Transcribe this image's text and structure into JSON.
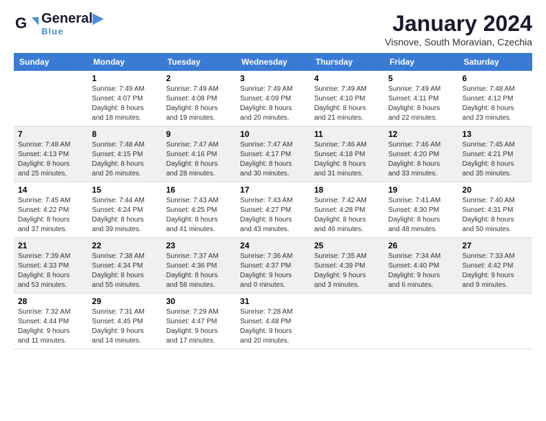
{
  "logo": {
    "general": "General",
    "blue": "Blue",
    "subtitle": ""
  },
  "header": {
    "title": "January 2024",
    "location": "Visnove, South Moravian, Czechia"
  },
  "columns": [
    "Sunday",
    "Monday",
    "Tuesday",
    "Wednesday",
    "Thursday",
    "Friday",
    "Saturday"
  ],
  "weeks": [
    {
      "days": [
        {
          "num": "",
          "info": ""
        },
        {
          "num": "1",
          "info": "Sunrise: 7:49 AM\nSunset: 4:07 PM\nDaylight: 8 hours\nand 18 minutes."
        },
        {
          "num": "2",
          "info": "Sunrise: 7:49 AM\nSunset: 4:08 PM\nDaylight: 8 hours\nand 19 minutes."
        },
        {
          "num": "3",
          "info": "Sunrise: 7:49 AM\nSunset: 4:09 PM\nDaylight: 8 hours\nand 20 minutes."
        },
        {
          "num": "4",
          "info": "Sunrise: 7:49 AM\nSunset: 4:10 PM\nDaylight: 8 hours\nand 21 minutes."
        },
        {
          "num": "5",
          "info": "Sunrise: 7:49 AM\nSunset: 4:11 PM\nDaylight: 8 hours\nand 22 minutes."
        },
        {
          "num": "6",
          "info": "Sunrise: 7:48 AM\nSunset: 4:12 PM\nDaylight: 8 hours\nand 23 minutes."
        }
      ]
    },
    {
      "days": [
        {
          "num": "7",
          "info": "Sunrise: 7:48 AM\nSunset: 4:13 PM\nDaylight: 8 hours\nand 25 minutes."
        },
        {
          "num": "8",
          "info": "Sunrise: 7:48 AM\nSunset: 4:15 PM\nDaylight: 8 hours\nand 26 minutes."
        },
        {
          "num": "9",
          "info": "Sunrise: 7:47 AM\nSunset: 4:16 PM\nDaylight: 8 hours\nand 28 minutes."
        },
        {
          "num": "10",
          "info": "Sunrise: 7:47 AM\nSunset: 4:17 PM\nDaylight: 8 hours\nand 30 minutes."
        },
        {
          "num": "11",
          "info": "Sunrise: 7:46 AM\nSunset: 4:18 PM\nDaylight: 8 hours\nand 31 minutes."
        },
        {
          "num": "12",
          "info": "Sunrise: 7:46 AM\nSunset: 4:20 PM\nDaylight: 8 hours\nand 33 minutes."
        },
        {
          "num": "13",
          "info": "Sunrise: 7:45 AM\nSunset: 4:21 PM\nDaylight: 8 hours\nand 35 minutes."
        }
      ]
    },
    {
      "days": [
        {
          "num": "14",
          "info": "Sunrise: 7:45 AM\nSunset: 4:22 PM\nDaylight: 8 hours\nand 37 minutes."
        },
        {
          "num": "15",
          "info": "Sunrise: 7:44 AM\nSunset: 4:24 PM\nDaylight: 8 hours\nand 39 minutes."
        },
        {
          "num": "16",
          "info": "Sunrise: 7:43 AM\nSunset: 4:25 PM\nDaylight: 8 hours\nand 41 minutes."
        },
        {
          "num": "17",
          "info": "Sunrise: 7:43 AM\nSunset: 4:27 PM\nDaylight: 8 hours\nand 43 minutes."
        },
        {
          "num": "18",
          "info": "Sunrise: 7:42 AM\nSunset: 4:28 PM\nDaylight: 8 hours\nand 46 minutes."
        },
        {
          "num": "19",
          "info": "Sunrise: 7:41 AM\nSunset: 4:30 PM\nDaylight: 8 hours\nand 48 minutes."
        },
        {
          "num": "20",
          "info": "Sunrise: 7:40 AM\nSunset: 4:31 PM\nDaylight: 8 hours\nand 50 minutes."
        }
      ]
    },
    {
      "days": [
        {
          "num": "21",
          "info": "Sunrise: 7:39 AM\nSunset: 4:33 PM\nDaylight: 8 hours\nand 53 minutes."
        },
        {
          "num": "22",
          "info": "Sunrise: 7:38 AM\nSunset: 4:34 PM\nDaylight: 8 hours\nand 55 minutes."
        },
        {
          "num": "23",
          "info": "Sunrise: 7:37 AM\nSunset: 4:36 PM\nDaylight: 8 hours\nand 58 minutes."
        },
        {
          "num": "24",
          "info": "Sunrise: 7:36 AM\nSunset: 4:37 PM\nDaylight: 9 hours\nand 0 minutes."
        },
        {
          "num": "25",
          "info": "Sunrise: 7:35 AM\nSunset: 4:39 PM\nDaylight: 9 hours\nand 3 minutes."
        },
        {
          "num": "26",
          "info": "Sunrise: 7:34 AM\nSunset: 4:40 PM\nDaylight: 9 hours\nand 6 minutes."
        },
        {
          "num": "27",
          "info": "Sunrise: 7:33 AM\nSunset: 4:42 PM\nDaylight: 9 hours\nand 9 minutes."
        }
      ]
    },
    {
      "days": [
        {
          "num": "28",
          "info": "Sunrise: 7:32 AM\nSunset: 4:44 PM\nDaylight: 9 hours\nand 11 minutes."
        },
        {
          "num": "29",
          "info": "Sunrise: 7:31 AM\nSunset: 4:45 PM\nDaylight: 9 hours\nand 14 minutes."
        },
        {
          "num": "30",
          "info": "Sunrise: 7:29 AM\nSunset: 4:47 PM\nDaylight: 9 hours\nand 17 minutes."
        },
        {
          "num": "31",
          "info": "Sunrise: 7:28 AM\nSunset: 4:48 PM\nDaylight: 9 hours\nand 20 minutes."
        },
        {
          "num": "",
          "info": ""
        },
        {
          "num": "",
          "info": ""
        },
        {
          "num": "",
          "info": ""
        }
      ]
    }
  ]
}
